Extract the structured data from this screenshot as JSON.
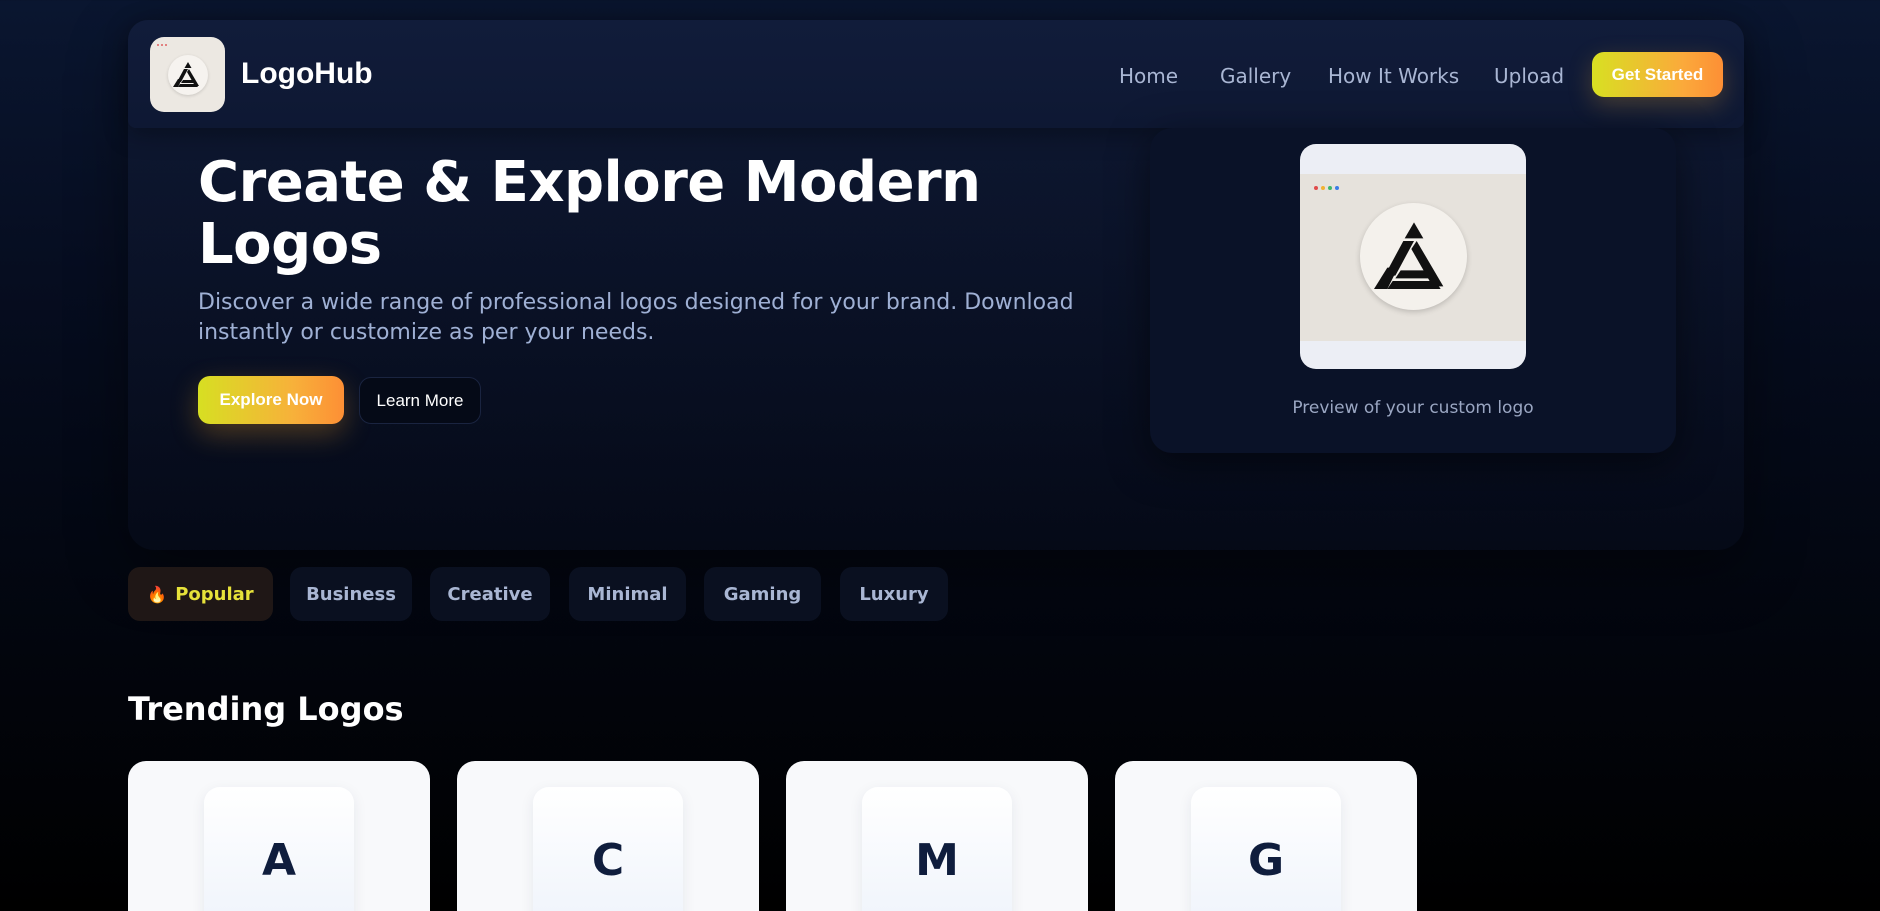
{
  "brand": {
    "name": "LogoHub",
    "logo_icon": "triangle-mark-icon"
  },
  "nav": {
    "links": [
      "Home",
      "Gallery",
      "How It Works",
      "Upload"
    ],
    "cta": "Get Started"
  },
  "hero": {
    "title": "Create & Explore Modern Logos",
    "subtitle": "Discover a wide range of professional logos designed for your brand. Download instantly or customize as per your needs.",
    "primary_button": "Explore Now",
    "secondary_button": "Learn More"
  },
  "preview": {
    "caption": "Preview of your custom logo",
    "dot_colors": [
      "#e04b4b",
      "#f2b233",
      "#3fb76a",
      "#3b7de6"
    ]
  },
  "categories": {
    "items": [
      "Popular",
      "Business",
      "Creative",
      "Minimal",
      "Gaming",
      "Luxury"
    ],
    "active": "Popular",
    "active_icon": "fire-icon"
  },
  "trending": {
    "title": "Trending Logos",
    "cards": [
      {
        "letter": "A"
      },
      {
        "letter": "C"
      },
      {
        "letter": "M"
      },
      {
        "letter": "G"
      }
    ]
  },
  "colors": {
    "accent_start": "#d8e022",
    "accent_end": "#fd8f35",
    "active_category_text": "#e7e23a"
  }
}
